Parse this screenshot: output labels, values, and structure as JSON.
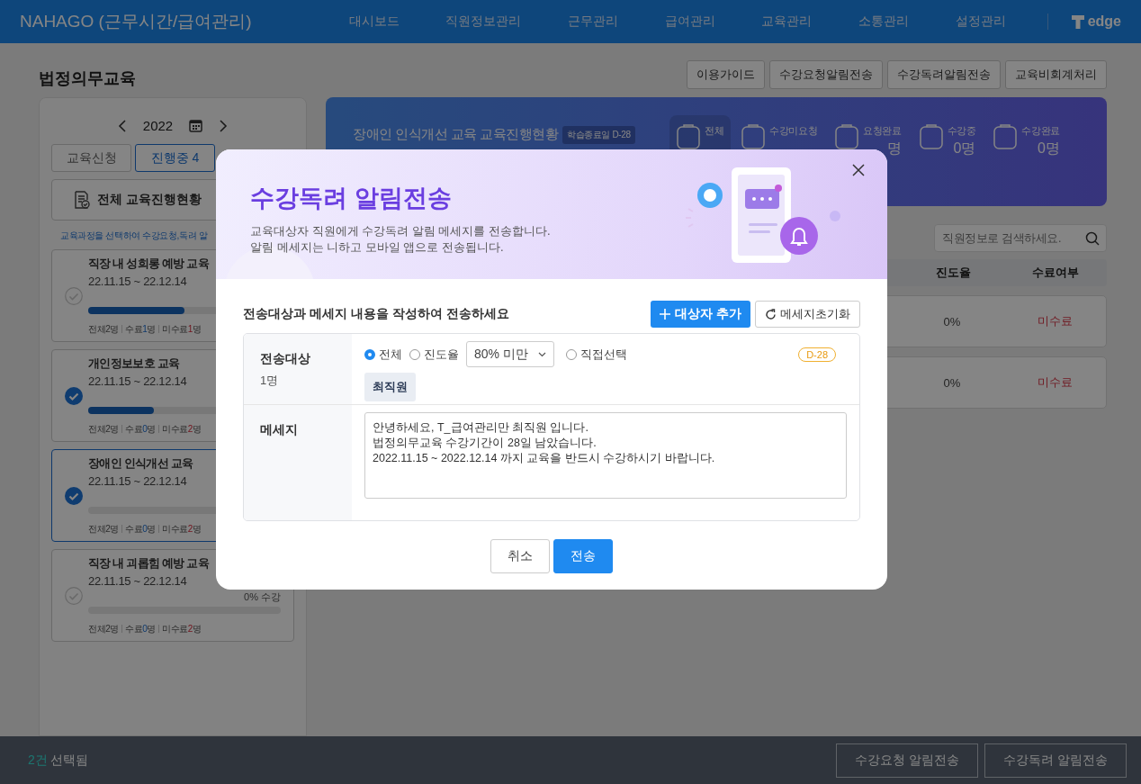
{
  "header": {
    "brand": "NAHAGO (근무시간/급여관리)",
    "nav": [
      {
        "label": "대시보드"
      },
      {
        "label": "직원정보관리"
      },
      {
        "label": "근무관리"
      },
      {
        "label": "급여관리"
      },
      {
        "label": "교육관리"
      },
      {
        "label": "소통관리"
      },
      {
        "label": "설정관리"
      }
    ],
    "logo_text": "edge"
  },
  "page_title": "법정의무교육",
  "top_buttons": [
    "이용가이드",
    "수강요청알림전송",
    "수강독려알림전송",
    "교육비회계처리"
  ],
  "sidebar": {
    "year": "2022",
    "tabs": [
      {
        "label": "교육신청",
        "selected": false
      },
      {
        "label": "진행중 4",
        "selected": true
      }
    ],
    "overview_button": "전체 교육진행현황",
    "hint": "교육과정을 선택하여 수강요청,독려 알",
    "courses": [
      {
        "title": "직장 내 성희롱 예방 교육",
        "dates": "22.11.15 ~ 22.12.14",
        "checked": false,
        "selected": false,
        "level": 0.5,
        "stats": [
          {
            "kind": "total",
            "label": "전체",
            "value": "2",
            "unit": "명"
          },
          {
            "kind": "done",
            "label": "수료",
            "value": "1",
            "unit": "명"
          },
          {
            "kind": "undone",
            "label": "미수료",
            "value": "1",
            "unit": "명"
          }
        ]
      },
      {
        "title": "개인정보보호 교육",
        "dates": "22.11.15 ~ 22.12.14",
        "checked": true,
        "selected": false,
        "level": 0.34,
        "stats": [
          {
            "kind": "total",
            "label": "전체",
            "value": "2",
            "unit": "명"
          },
          {
            "kind": "done",
            "label": "수료",
            "value": "0",
            "unit": "명"
          },
          {
            "kind": "undone",
            "label": "미수료",
            "value": "2",
            "unit": "명"
          }
        ]
      },
      {
        "title": "장애인 인식개선 교육",
        "dates": "22.11.15 ~ 22.12.14",
        "checked": true,
        "selected": true,
        "level": 0,
        "stats": [
          {
            "kind": "total",
            "label": "전체",
            "value": "2",
            "unit": "명"
          },
          {
            "kind": "done",
            "label": "수료",
            "value": "0",
            "unit": "명"
          },
          {
            "kind": "undone",
            "label": "미수료",
            "value": "2",
            "unit": "명"
          }
        ]
      },
      {
        "title": "직장 내 괴롭힘 예방 교육",
        "dates": "22.11.15 ~ 22.12.14",
        "checked": false,
        "selected": false,
        "level": 0,
        "progress_text": "0% 수강",
        "stats": [
          {
            "kind": "total",
            "label": "전체",
            "value": "2",
            "unit": "명"
          },
          {
            "kind": "done",
            "label": "수료",
            "value": "0",
            "unit": "명"
          },
          {
            "kind": "undone",
            "label": "미수료",
            "value": "2",
            "unit": "명"
          }
        ]
      }
    ]
  },
  "banner": {
    "title": "장애인 인식개선 교육 교육진행현황",
    "badge": "학습종료일 D-28",
    "stats": [
      {
        "label": "전체",
        "selected": true
      },
      {
        "label": "수강미요청",
        "selected": false
      },
      {
        "label": "요청완료",
        "count": "명",
        "selected": false
      },
      {
        "label": "수강중",
        "count": "0명",
        "selected": false
      },
      {
        "label": "수강완료",
        "count": "0명",
        "selected": false
      }
    ]
  },
  "search": {
    "placeholder": "직원정보로 검색하세요."
  },
  "table": {
    "columns": [
      "진도율",
      "수료여부"
    ],
    "rows": [
      {
        "progress": "0%",
        "completion": "미수료"
      },
      {
        "progress": "0%",
        "completion": "미수료"
      }
    ]
  },
  "bottom_bar": {
    "count": "2건",
    "label": "선택됨",
    "buttons": [
      "수강요청 알림전송",
      "수강독려 알림전송"
    ]
  },
  "modal": {
    "title": "수강독려 알림전송",
    "description": [
      "교육대상자 직원에게 수강독려 알림 메세지를 전송합니다.",
      "알림 메세지는 니하고 모바일 앱으로 전송됩니다."
    ],
    "section_title": "전송대상과 메세지 내용을 작성하여 전송하세요",
    "add_button": "대상자 추가",
    "reset_button": "메세지초기화",
    "target": {
      "label": "전송대상",
      "count": "1명",
      "options": [
        {
          "label": "전체",
          "selected": true
        },
        {
          "label": "진도율",
          "selected": false,
          "select_value": "80% 미만"
        },
        {
          "label": "직접선택",
          "selected": false
        }
      ],
      "badge": "D-28",
      "chips": [
        "최직원"
      ]
    },
    "message": {
      "label": "메세지",
      "value": "안녕하세요, T_급여관리만 최직원 입니다.\n법정의무교육 수강기간이 28일 남았습니다.\n2022.11.15 ~ 2022.12.14 까지 교육을 반드시 수강하시기 바랍니다."
    },
    "buttons": [
      {
        "kind": "secondary",
        "label": "취소"
      },
      {
        "kind": "primary",
        "label": "전송"
      }
    ]
  }
}
